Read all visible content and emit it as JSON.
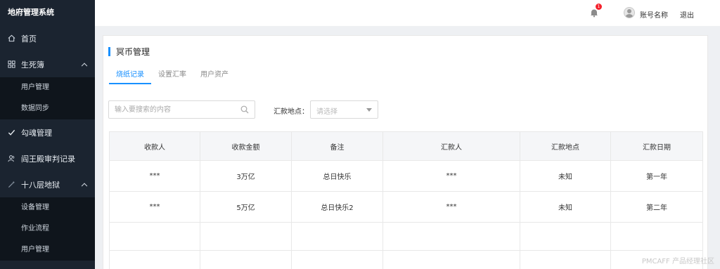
{
  "app": {
    "title": "地府管理系统"
  },
  "sidebar": {
    "items": [
      {
        "label": "首页",
        "icon": "home-icon"
      },
      {
        "label": "生死簿",
        "icon": "grid-icon",
        "expanded": true,
        "children": [
          {
            "label": "用户管理"
          },
          {
            "label": "数据同步"
          }
        ]
      },
      {
        "label": "勾魂管理",
        "icon": "check-icon"
      },
      {
        "label": "阎王殿审判记录",
        "icon": "people-icon"
      },
      {
        "label": "十八层地狱",
        "icon": "wand-icon",
        "expanded": true,
        "children": [
          {
            "label": "设备管理"
          },
          {
            "label": "作业流程"
          },
          {
            "label": "用户管理"
          }
        ]
      }
    ]
  },
  "topbar": {
    "notification_count": "1",
    "account_label": "账号名称",
    "logout_label": "退出"
  },
  "page": {
    "title": "冥币管理",
    "tabs": [
      {
        "label": "烧纸记录",
        "active": true
      },
      {
        "label": "设置汇率",
        "active": false
      },
      {
        "label": "用户资产",
        "active": false
      }
    ],
    "search": {
      "placeholder": "输入要搜索的内容",
      "value": ""
    },
    "filter": {
      "label": "汇款地点：",
      "placeholder": "请选择"
    },
    "table": {
      "columns": [
        "收款人",
        "收款金额",
        "备注",
        "汇款人",
        "汇款地点",
        "汇款日期"
      ],
      "rows": [
        [
          "***",
          "3万亿",
          "总日快乐",
          "***",
          "未知",
          "第一年"
        ],
        [
          "***",
          "5万亿",
          "总日快乐2",
          "***",
          "未知",
          "第二年"
        ]
      ]
    }
  },
  "watermark": "PMCAFF 产品经理社区",
  "colors": {
    "accent": "#1890ff",
    "sidebar_bg": "#1b2430",
    "badge": "#f5222d"
  }
}
